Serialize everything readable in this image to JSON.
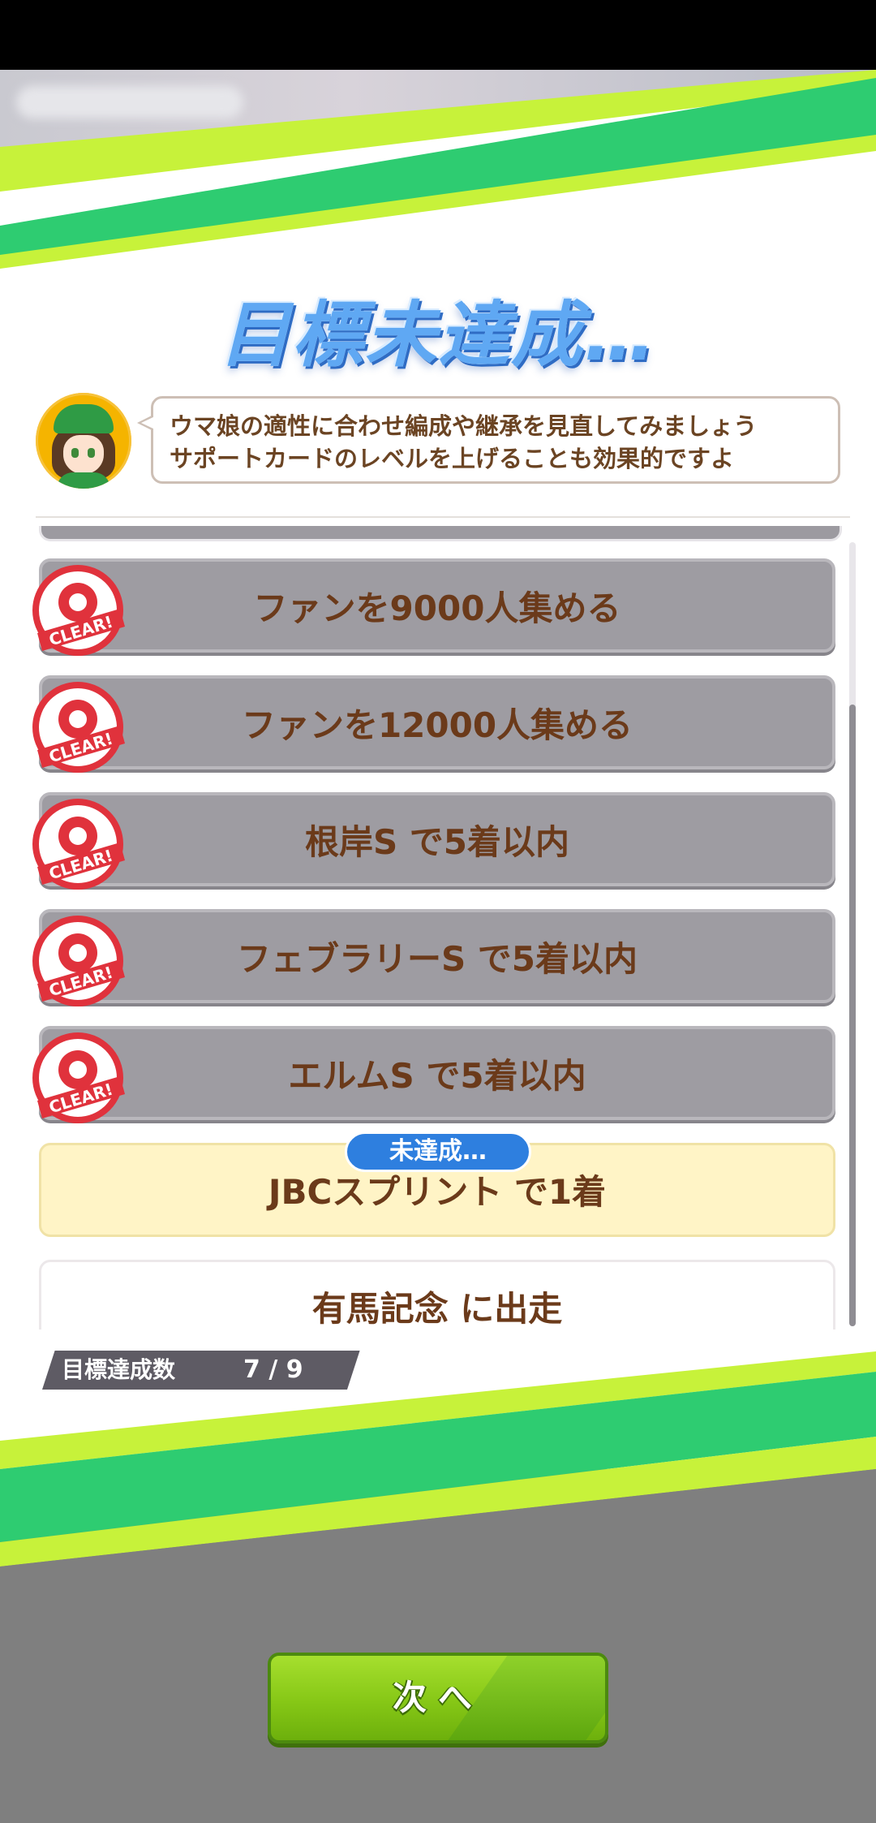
{
  "title": "目標未達成…",
  "advisor": {
    "message_line1": "ウマ娘の適性に合わせ編成や継承を見直してみましょう",
    "message_line2": "サポートカードのレベルを上げることも効果的ですよ"
  },
  "stamp_label": "CLEAR!",
  "goals": [
    {
      "label": "ファンを9000人集める",
      "status": "clear"
    },
    {
      "label": "ファンを12000人集める",
      "status": "clear"
    },
    {
      "label": "根岸S で5着以内",
      "status": "clear"
    },
    {
      "label": "フェブラリーS で5着以内",
      "status": "clear"
    },
    {
      "label": "エルムS で5着以内",
      "status": "clear"
    },
    {
      "label": "JBCスプリント で1着",
      "status": "failed",
      "badge": "未達成…"
    },
    {
      "label": "有馬記念 に出走",
      "status": "none"
    }
  ],
  "summary": {
    "label": "目標達成数",
    "value": "7 / 9"
  },
  "next_button": "次へ",
  "colors": {
    "accent_green": "#2ecc71",
    "accent_lime": "#c7f23a",
    "pending_badge": "#2e7fdf",
    "text_brown": "#6b3a1a"
  }
}
